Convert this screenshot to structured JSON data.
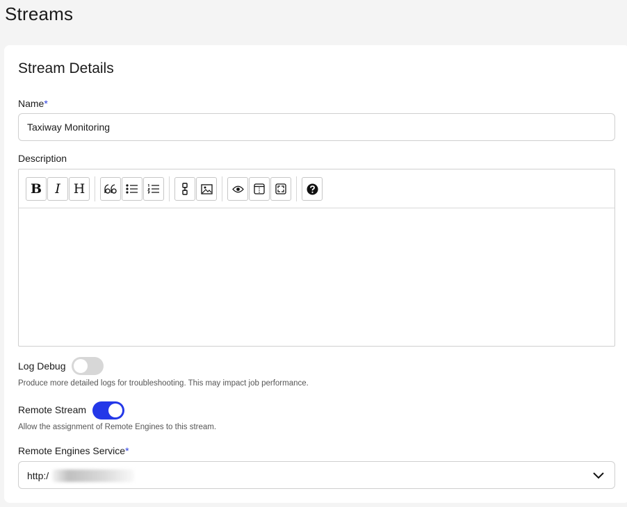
{
  "page": {
    "title": "Streams"
  },
  "stream_details": {
    "title": "Stream Details",
    "name": {
      "label": "Name",
      "required_mark": "*",
      "value": "Taxiway Monitoring"
    },
    "description": {
      "label": "Description",
      "toolbar": {
        "bold": "B",
        "italic": "I",
        "heading": "H",
        "icons": [
          "quote-icon",
          "unordered-list-icon",
          "ordered-list-icon",
          "link-icon",
          "image-icon",
          "preview-icon",
          "side-by-side-icon",
          "fullscreen-icon",
          "help-icon"
        ]
      },
      "value": ""
    },
    "log_debug": {
      "label": "Log Debug",
      "enabled": false,
      "help": "Produce more detailed logs for troubleshooting. This may impact job performance."
    },
    "remote_stream": {
      "label": "Remote Stream",
      "enabled": true,
      "help": "Allow the assignment of Remote Engines to this stream."
    },
    "remote_engines_service": {
      "label": "Remote Engines Service",
      "required_mark": "*",
      "value": "http:/"
    }
  },
  "colors": {
    "accent": "#2438e8",
    "toggle_off": "#d7d7d7",
    "required": "#2b3fe0"
  }
}
